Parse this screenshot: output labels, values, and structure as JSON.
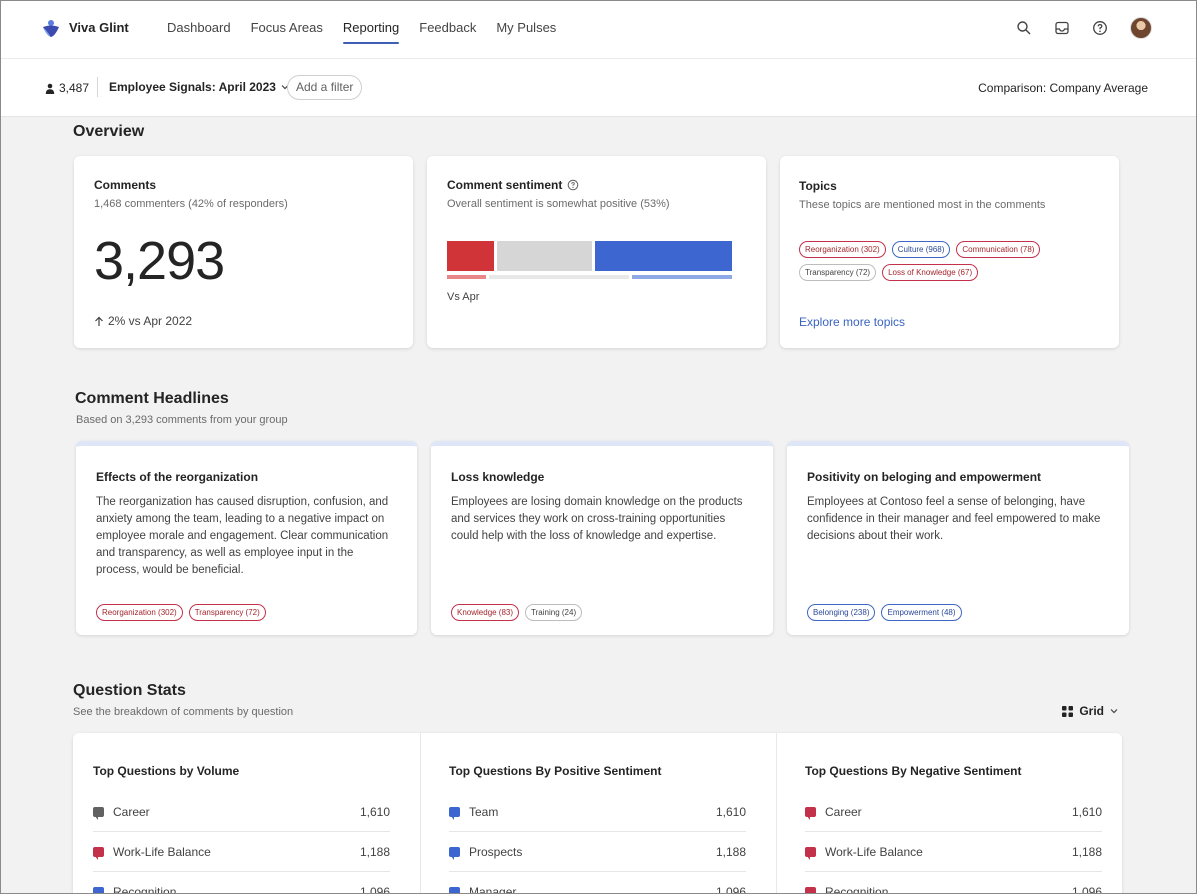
{
  "brand": "Viva Glint",
  "nav": {
    "links": [
      "Dashboard",
      "Focus Areas",
      "Reporting",
      "Feedback",
      "My Pulses"
    ],
    "active": "Reporting"
  },
  "filter": {
    "people_count": "3,487",
    "survey": "Employee Signals: April 2023",
    "add_filter": "Add a filter",
    "comparison": "Comparison: Company Average"
  },
  "overview": {
    "title": "Overview",
    "comments": {
      "title": "Comments",
      "subtitle": "1,468 commenters (42% of responders)",
      "total": "3,293",
      "delta": "2% vs Apr 2022"
    },
    "sentiment": {
      "title": "Comment sentiment",
      "subtitle": "Overall sentiment is somewhat positive (53%)",
      "vs_label": "Vs Apr",
      "current": {
        "negative": 17,
        "neutral": 34,
        "positive": 49
      },
      "previous": {
        "negative": 14,
        "neutral": 50,
        "positive": 36
      },
      "colors": {
        "negative": "#d13438",
        "neutral": "#d6d6d6",
        "positive": "#3e66d0"
      }
    },
    "topics": {
      "title": "Topics",
      "subtitle": "These topics are mentioned most in the comments",
      "tags": [
        {
          "label": "Reorganization (302)",
          "tone": "neg"
        },
        {
          "label": "Culture (968)",
          "tone": "pos"
        },
        {
          "label": "Communication (78)",
          "tone": "neg"
        },
        {
          "label": "Transparency (72)",
          "tone": "neu"
        },
        {
          "label": "Loss of Knowledge (67)",
          "tone": "neg"
        }
      ],
      "explore": "Explore more topics"
    }
  },
  "headlines": {
    "title": "Comment Headlines",
    "subtitle": "Based on 3,293 comments from your group",
    "cards": [
      {
        "title": "Effects of the reorganization",
        "body": "The reorganization has caused disruption, confusion, and anxiety among the team, leading to a negative impact on employee morale and engagement. Clear communication and transparency, as well as employee input in the process, would be beneficial.",
        "tags": [
          {
            "label": "Reorganization (302)",
            "tone": "neg"
          },
          {
            "label": "Transparency (72)",
            "tone": "neg"
          }
        ]
      },
      {
        "title": "Loss knowledge",
        "body": "Employees are losing domain knowledge on the products and services they work on cross-training opportunities could help with the loss of knowledge and expertise.",
        "tags": [
          {
            "label": "Knowledge (83)",
            "tone": "neg"
          },
          {
            "label": "Training (24)",
            "tone": "neu"
          }
        ]
      },
      {
        "title": "Positivity on beloging and empowerment",
        "body": "Employees at Contoso feel a sense of belonging, have confidence in their manager and feel empowered to make decisions about their work.",
        "tags": [
          {
            "label": "Belonging (238)",
            "tone": "pos"
          },
          {
            "label": "Empowerment (48)",
            "tone": "pos"
          }
        ]
      }
    ]
  },
  "question_stats": {
    "title": "Question Stats",
    "subtitle": "See the breakdown of comments by question",
    "view": "Grid",
    "columns": [
      {
        "title": "Top Questions by Volume",
        "rows": [
          {
            "label": "Career",
            "count": "1,610",
            "color": "#616161"
          },
          {
            "label": "Work-Life Balance",
            "count": "1,188",
            "color": "#c4314b"
          },
          {
            "label": "Recognition",
            "count": "1,096",
            "color": "#3e66d0"
          }
        ]
      },
      {
        "title": "Top Questions By Positive Sentiment",
        "rows": [
          {
            "label": "Team",
            "count": "1,610",
            "color": "#3e66d0"
          },
          {
            "label": "Prospects",
            "count": "1,188",
            "color": "#3e66d0"
          },
          {
            "label": "Manager",
            "count": "1,096",
            "color": "#3e66d0"
          }
        ]
      },
      {
        "title": "Top Questions By Negative Sentiment",
        "rows": [
          {
            "label": "Career",
            "count": "1,610",
            "color": "#c4314b"
          },
          {
            "label": "Work-Life Balance",
            "count": "1,188",
            "color": "#c4314b"
          },
          {
            "label": "Recognition",
            "count": "1,096",
            "color": "#c4314b"
          }
        ]
      }
    ]
  }
}
